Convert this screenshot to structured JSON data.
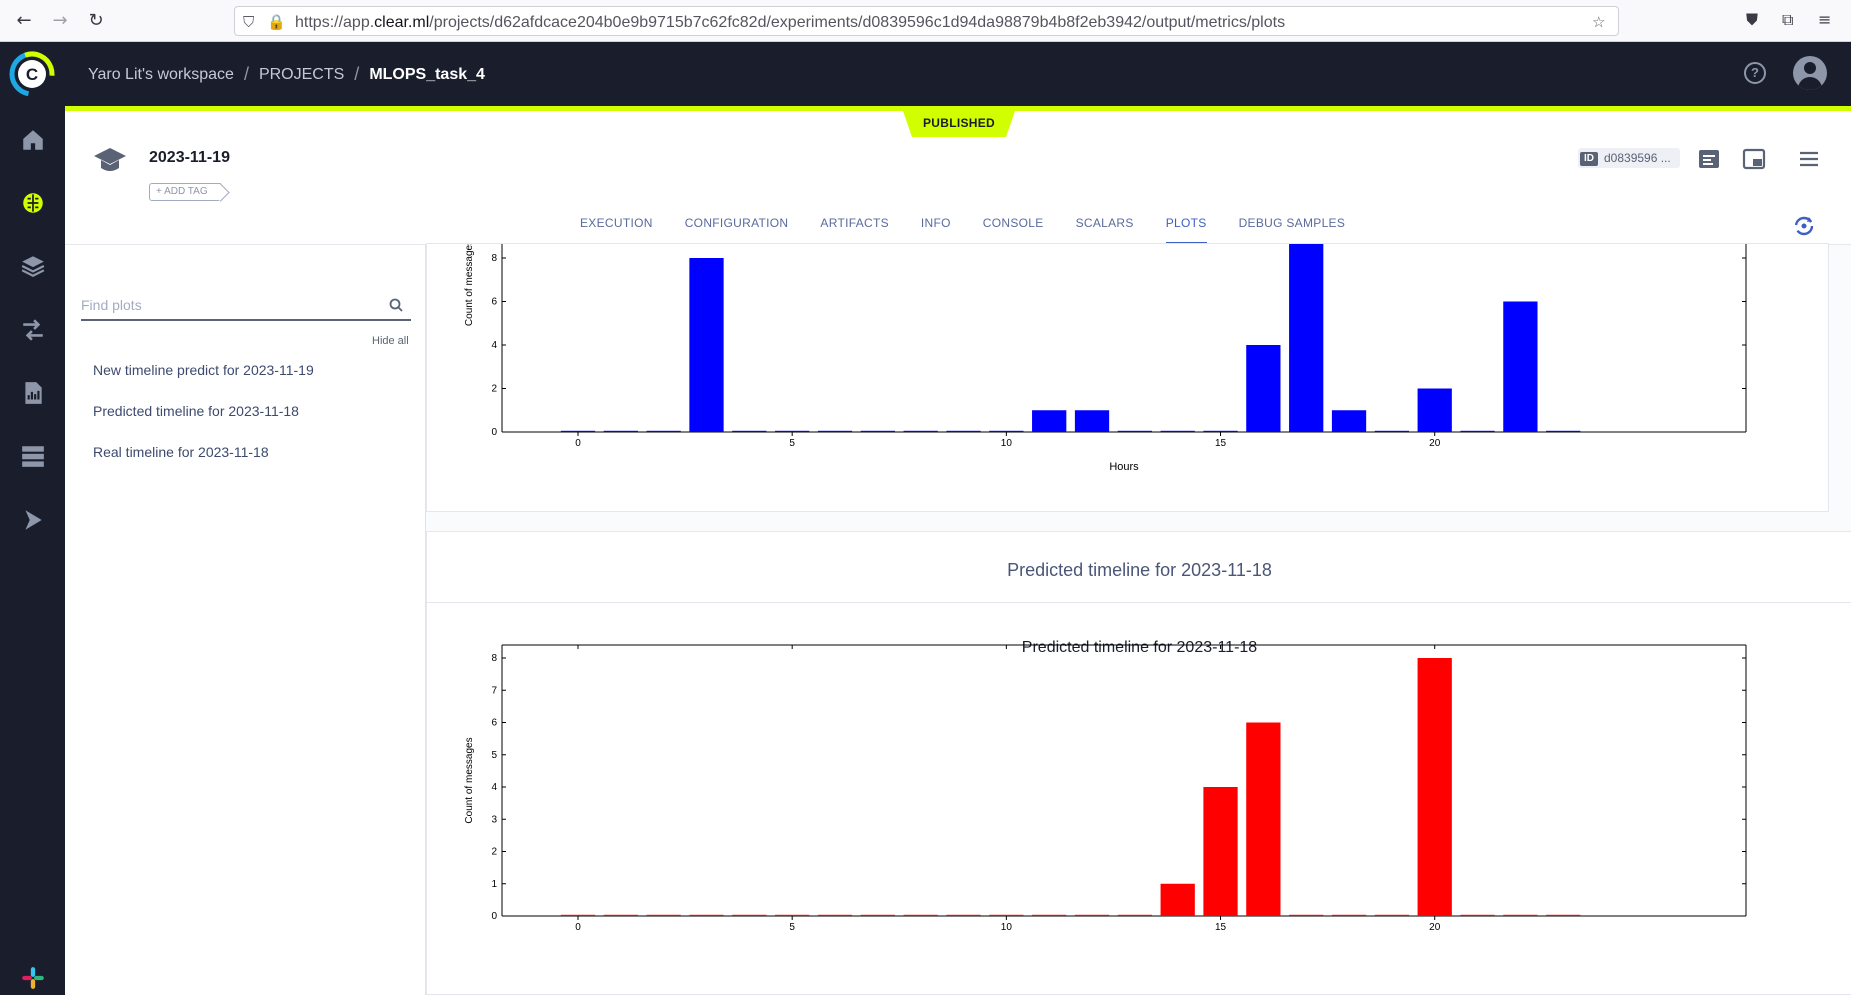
{
  "browser": {
    "url_prefix": "https://app.",
    "url_domain": "clear.ml",
    "url_path": "/projects/d62afdcace204b0e9b9715b7c62fc82d/experiments/d0839596c1d94da98879b4b8f2eb3942/output/metrics/plots"
  },
  "header": {
    "workspace": "Yaro Lit's workspace",
    "projects": "PROJECTS",
    "project": "MLOPS_task_4"
  },
  "status": "PUBLISHED",
  "experiment": {
    "title": "2023-11-19",
    "add_tag": "+ ADD TAG",
    "id_label": "ID",
    "id_value": "d0839596 ..."
  },
  "tabs": [
    "EXECUTION",
    "CONFIGURATION",
    "ARTIFACTS",
    "INFO",
    "CONSOLE",
    "SCALARS",
    "PLOTS",
    "DEBUG SAMPLES"
  ],
  "active_tab": "PLOTS",
  "left_panel": {
    "search_placeholder": "Find plots",
    "hide_all": "Hide all",
    "plots": [
      "New timeline predict for 2023-11-19",
      "Predicted timeline for 2023-11-18",
      "Real timeline for 2023-11-18"
    ]
  },
  "sections": {
    "predicted_title": "Predicted timeline for 2023-11-18"
  },
  "colors": {
    "accent": "#d2ff00",
    "header_bg": "#1a1e2c",
    "bar_blue": "#0000ff",
    "bar_red": "#ff0000"
  },
  "chart_data": [
    {
      "type": "bar",
      "title": "",
      "xlabel": "Hours",
      "ylabel": "Count of messages",
      "x": [
        0,
        1,
        2,
        3,
        4,
        5,
        6,
        7,
        8,
        9,
        10,
        11,
        12,
        13,
        14,
        15,
        16,
        17,
        18,
        19,
        20,
        21,
        22,
        23
      ],
      "values": [
        0,
        0,
        0,
        8,
        0,
        0,
        0,
        0,
        0,
        0,
        0,
        1,
        1,
        0,
        0,
        0,
        4,
        9,
        1,
        0,
        2,
        0,
        6,
        0
      ],
      "xticks": [
        0,
        5,
        10,
        15,
        20
      ],
      "yticks": [
        0,
        2,
        4,
        6,
        8
      ],
      "ylim_visible": [
        0,
        8.7
      ],
      "color": "#0000ff"
    },
    {
      "type": "bar",
      "title": "Predicted timeline for 2023-11-18",
      "xlabel": "",
      "ylabel": "Count of messages",
      "x": [
        0,
        1,
        2,
        3,
        4,
        5,
        6,
        7,
        8,
        9,
        10,
        11,
        12,
        13,
        14,
        15,
        16,
        17,
        18,
        19,
        20,
        21,
        22,
        23
      ],
      "values": [
        0,
        0,
        0,
        0,
        0,
        0,
        0,
        0,
        0,
        0,
        0,
        0,
        0,
        0,
        1,
        4,
        6,
        0,
        0,
        0,
        8,
        0,
        0,
        0
      ],
      "xticks": [
        0,
        5,
        10,
        15,
        20
      ],
      "yticks": [
        0,
        1,
        2,
        3,
        4,
        5,
        6,
        7,
        8
      ],
      "ylim": [
        0,
        8.4
      ],
      "color": "#ff0000"
    }
  ]
}
